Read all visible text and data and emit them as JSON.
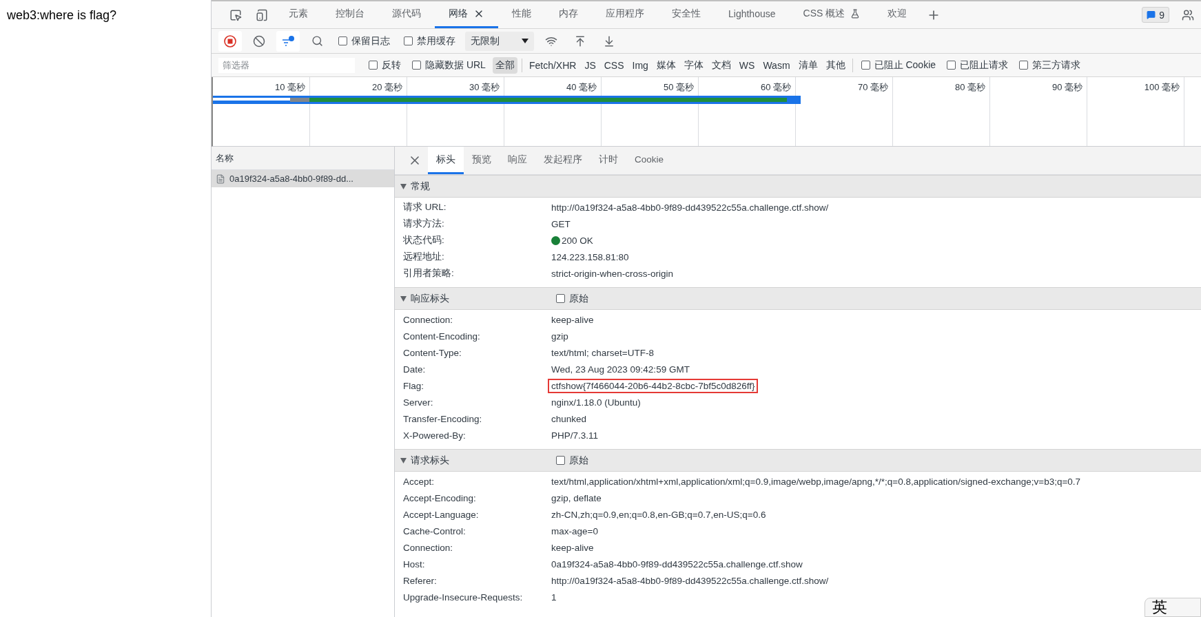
{
  "page": {
    "heading": "web3:where is flag?"
  },
  "devtools": {
    "tabs": [
      {
        "label": "元素",
        "selected": false
      },
      {
        "label": "控制台",
        "selected": false
      },
      {
        "label": "源代码",
        "selected": false
      },
      {
        "label": "网络",
        "selected": true,
        "closable": true
      },
      {
        "label": "性能",
        "selected": false
      },
      {
        "label": "内存",
        "selected": false
      },
      {
        "label": "应用程序",
        "selected": false
      },
      {
        "label": "安全性",
        "selected": false
      },
      {
        "label": "Lighthouse",
        "selected": false
      },
      {
        "label": "CSS 概述",
        "selected": false,
        "experimental": true
      },
      {
        "label": "欢迎",
        "selected": false
      }
    ],
    "issues_count": "9",
    "toolbar": {
      "recording": true,
      "filter_active": true,
      "options": [
        {
          "label": "保留日志",
          "checked": false
        },
        {
          "label": "禁用缓存",
          "checked": false
        }
      ],
      "throttling": "无限制"
    },
    "filter": {
      "placeholder": "筛选器",
      "options": [
        {
          "label": "反转",
          "checked": false
        },
        {
          "label": "隐藏数据 URL",
          "checked": false
        }
      ],
      "types": [
        {
          "label": "全部",
          "selected": true
        },
        {
          "label": "Fetch/XHR",
          "selected": false
        },
        {
          "label": "JS",
          "selected": false
        },
        {
          "label": "CSS",
          "selected": false
        },
        {
          "label": "Img",
          "selected": false
        },
        {
          "label": "媒体",
          "selected": false
        },
        {
          "label": "字体",
          "selected": false
        },
        {
          "label": "文档",
          "selected": false
        },
        {
          "label": "WS",
          "selected": false
        },
        {
          "label": "Wasm",
          "selected": false
        },
        {
          "label": "清单",
          "selected": false
        },
        {
          "label": "其他",
          "selected": false
        }
      ],
      "extra_options": [
        {
          "label": "已阻止 Cookie",
          "checked": false
        },
        {
          "label": "已阻止请求",
          "checked": false
        },
        {
          "label": "第三方请求",
          "checked": false
        }
      ]
    },
    "timeline": {
      "ticks": [
        "10 毫秒",
        "20 毫秒",
        "30 毫秒",
        "40 毫秒",
        "50 毫秒",
        "60 毫秒",
        "70 毫秒",
        "80 毫秒",
        "90 毫秒",
        "100 毫秒"
      ]
    },
    "requests": {
      "column": "名称",
      "items": [
        {
          "name": "0a19f324-a5a8-4bb0-9f89-dd...",
          "selected": true
        }
      ]
    },
    "detail_tabs": [
      {
        "label": "标头",
        "selected": true
      },
      {
        "label": "预览",
        "selected": false
      },
      {
        "label": "响应",
        "selected": false
      },
      {
        "label": "发起程序",
        "selected": false
      },
      {
        "label": "计时",
        "selected": false
      },
      {
        "label": "Cookie",
        "selected": false
      }
    ],
    "sections": [
      {
        "title": "常规",
        "expanded": true,
        "rows": [
          {
            "name": "请求 URL:",
            "value": "http://0a19f324-a5a8-4bb0-9f89-dd439522c55a.challenge.ctf.show/",
            "highlighted": false
          },
          {
            "name": "请求方法:",
            "value": "GET",
            "highlighted": false
          },
          {
            "name": "状态代码:",
            "value": "200 OK",
            "highlighted": false,
            "color": "#188038"
          },
          {
            "name": "远程地址:",
            "value": "124.223.158.81:80",
            "highlighted": false
          },
          {
            "name": "引用者策略:",
            "value": "strict-origin-when-cross-origin",
            "highlighted": false
          }
        ]
      },
      {
        "title": "响应标头",
        "expanded": true,
        "raw": {
          "label": "原始",
          "checked": false
        },
        "rows": [
          {
            "name": "Connection:",
            "value": "keep-alive",
            "highlighted": false
          },
          {
            "name": "Content-Encoding:",
            "value": "gzip",
            "highlighted": false
          },
          {
            "name": "Content-Type:",
            "value": "text/html; charset=UTF-8",
            "highlighted": false
          },
          {
            "name": "Date:",
            "value": "Wed, 23 Aug 2023 09:42:59 GMT",
            "highlighted": false
          },
          {
            "name": "Flag:",
            "value": "ctfshow{7f466044-20b6-44b2-8cbc-7bf5c0d826ff}",
            "highlighted": true
          },
          {
            "name": "Server:",
            "value": "nginx/1.18.0 (Ubuntu)",
            "highlighted": false
          },
          {
            "name": "Transfer-Encoding:",
            "value": "chunked",
            "highlighted": false
          },
          {
            "name": "X-Powered-By:",
            "value": "PHP/7.3.11",
            "highlighted": false
          }
        ]
      },
      {
        "title": "请求标头",
        "expanded": true,
        "raw": {
          "label": "原始",
          "checked": false
        },
        "rows": [
          {
            "name": "Accept:",
            "value": "text/html,application/xhtml+xml,application/xml;q=0.9,image/webp,image/apng,*/*;q=0.8,application/signed-exchange;v=b3;q=0.7",
            "highlighted": false
          },
          {
            "name": "Accept-Encoding:",
            "value": "gzip, deflate",
            "highlighted": false
          },
          {
            "name": "Accept-Language:",
            "value": "zh-CN,zh;q=0.9,en;q=0.8,en-GB;q=0.7,en-US;q=0.6",
            "highlighted": false
          },
          {
            "name": "Cache-Control:",
            "value": "max-age=0",
            "highlighted": false
          },
          {
            "name": "Connection:",
            "value": "keep-alive",
            "highlighted": false
          },
          {
            "name": "Host:",
            "value": "0a19f324-a5a8-4bb0-9f89-dd439522c55a.challenge.ctf.show",
            "highlighted": false
          },
          {
            "name": "Referer:",
            "value": "http://0a19f324-a5a8-4bb0-9f89-dd439522c55a.challenge.ctf.show/",
            "highlighted": false
          },
          {
            "name": "Upgrade-Insecure-Requests:",
            "value": "1",
            "highlighted": false
          }
        ]
      }
    ]
  },
  "ime": {
    "label": "英"
  }
}
